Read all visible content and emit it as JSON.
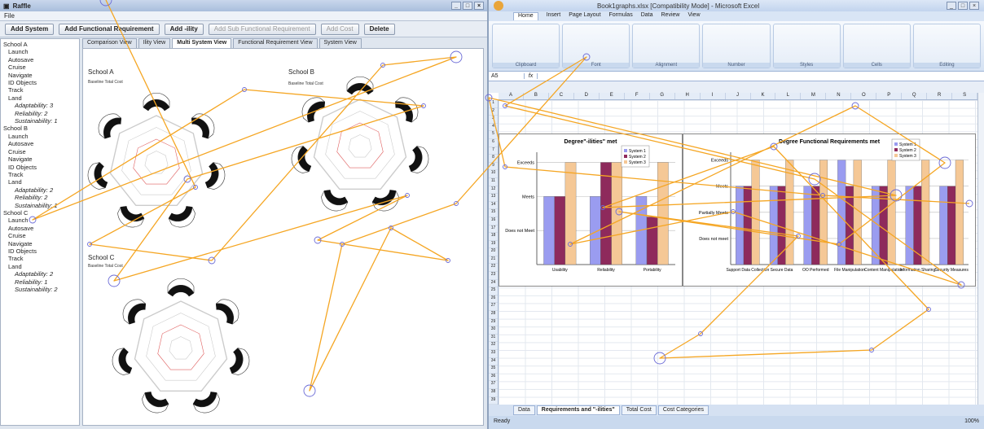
{
  "left_app": {
    "title": "Raffle",
    "menu": "File",
    "toolbar": [
      "Add System",
      "Add Functional Requirement",
      "Add -ility",
      "Add Sub Functional Requirement",
      "Add Cost",
      "Delete"
    ],
    "toolbar_disabled": [
      false,
      false,
      false,
      true,
      true,
      false
    ],
    "tree": [
      {
        "label": "School A",
        "level": 0
      },
      {
        "label": "Launch",
        "level": 1
      },
      {
        "label": "Autosave",
        "level": 1
      },
      {
        "label": "Cruise",
        "level": 1
      },
      {
        "label": "Navigate",
        "level": 1
      },
      {
        "label": "ID Objects",
        "level": 1
      },
      {
        "label": "Track",
        "level": 1
      },
      {
        "label": "Land",
        "level": 1
      },
      {
        "label": "Adaptability: 3",
        "level": 2
      },
      {
        "label": "Reliability: 2",
        "level": 2
      },
      {
        "label": "Sustainability: 1",
        "level": 2
      },
      {
        "label": "School B",
        "level": 0
      },
      {
        "label": "Launch",
        "level": 1
      },
      {
        "label": "Autosave",
        "level": 1
      },
      {
        "label": "Cruise",
        "level": 1
      },
      {
        "label": "Navigate",
        "level": 1
      },
      {
        "label": "ID Objects",
        "level": 1
      },
      {
        "label": "Track",
        "level": 1
      },
      {
        "label": "Land",
        "level": 1
      },
      {
        "label": "Adaptability: 2",
        "level": 2
      },
      {
        "label": "Reliability: 2",
        "level": 2
      },
      {
        "label": "Sustainability: 1",
        "level": 2
      },
      {
        "label": "School C",
        "level": 0
      },
      {
        "label": "Launch",
        "level": 1
      },
      {
        "label": "Autosave",
        "level": 1
      },
      {
        "label": "Cruise",
        "level": 1
      },
      {
        "label": "Navigate",
        "level": 1
      },
      {
        "label": "ID Objects",
        "level": 1
      },
      {
        "label": "Track",
        "level": 1
      },
      {
        "label": "Land",
        "level": 1
      },
      {
        "label": "Adaptability: 2",
        "level": 2
      },
      {
        "label": "Reliability: 1",
        "level": 2
      },
      {
        "label": "Sustainability: 2",
        "level": 2
      }
    ],
    "tabs": [
      "Comparison View",
      "Ility View",
      "Multi System View",
      "Functional Requirement View",
      "System View"
    ],
    "active_tab": 2,
    "panels": [
      "School A",
      "School B",
      "School C"
    ],
    "axis_note": "Baseline Total Cost"
  },
  "right_app": {
    "title": "Book1graphs.xlsx [Compatibility Mode] - Microsoft Excel",
    "ribbon_tabs": [
      "Home",
      "Insert",
      "Page Layout",
      "Formulas",
      "Data",
      "Review",
      "View"
    ],
    "active_ribbon_tab": 0,
    "ribbon_groups": [
      "Clipboard",
      "Font",
      "Alignment",
      "Number",
      "Styles",
      "Cells",
      "Editing"
    ],
    "name_box": "A5",
    "fx": "fx",
    "columns": [
      "A",
      "B",
      "C",
      "D",
      "E",
      "F",
      "G",
      "H",
      "I",
      "J",
      "K",
      "L",
      "M",
      "N",
      "O",
      "P",
      "Q",
      "R",
      "S"
    ],
    "sheet_tabs": [
      "Data",
      "Requirements and \"-ilities\"",
      "Total Cost",
      "Cost Categories"
    ],
    "active_sheet": 1,
    "status": "Ready",
    "zoom": "100%"
  },
  "chart_data": [
    {
      "type": "bar",
      "title": "Degree\"-ilities\" met",
      "categories": [
        "Usability",
        "Reliability",
        "Portability"
      ],
      "y_levels": [
        "Does not Meet",
        "Meets",
        "Exceeds"
      ],
      "series": [
        {
          "name": "System 1",
          "color": "#9a9cf0",
          "values": [
            2,
            2,
            2
          ]
        },
        {
          "name": "System 2",
          "color": "#8e2a5c",
          "values": [
            2,
            3,
            1.4
          ]
        },
        {
          "name": "System 3",
          "color": "#f5c896",
          "values": [
            3,
            3,
            3
          ]
        }
      ]
    },
    {
      "type": "bar",
      "title": "Degree Functional Requirements met",
      "categories": [
        "Support Data Collection",
        "Secure Data",
        "OO Performed",
        "File Manipulation",
        "Content Manipulation",
        "Information Sharing",
        "Security Measures"
      ],
      "y_levels": [
        "Does not meet",
        "Partially Meets",
        "Meets",
        "Exceeds"
      ],
      "series": [
        {
          "name": "System 1",
          "color": "#9a9cf0",
          "values": [
            3,
            3,
            3,
            4,
            3,
            3,
            3
          ]
        },
        {
          "name": "System 2",
          "color": "#8e2a5c",
          "values": [
            3,
            3,
            3,
            3,
            3,
            3,
            3
          ]
        },
        {
          "name": "System 3",
          "color": "#f5c896",
          "values": [
            4,
            4,
            4,
            4,
            4,
            4,
            4
          ]
        }
      ]
    }
  ],
  "colors": {
    "gaze": "#f5a623",
    "fixation": "#6b6bd6",
    "frame": "#8fa2bd"
  }
}
